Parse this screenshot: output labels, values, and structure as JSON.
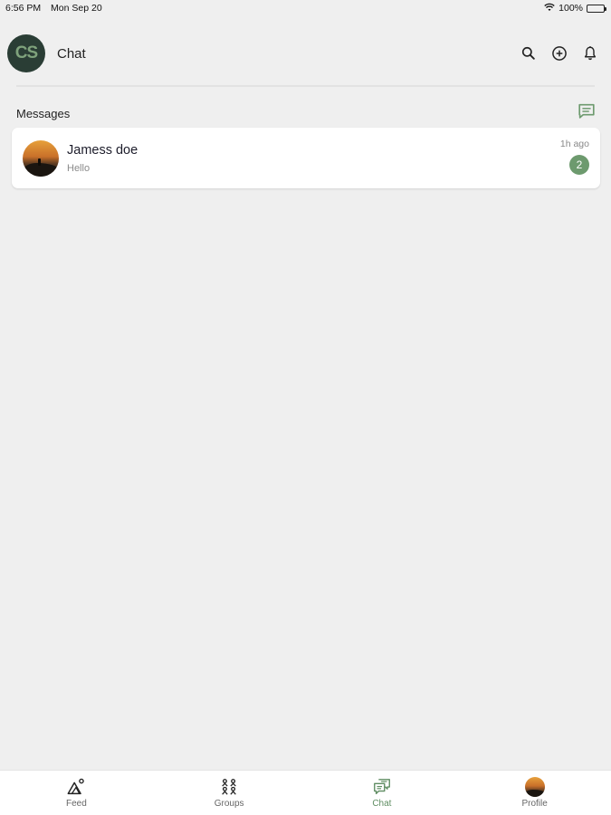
{
  "status_bar": {
    "time": "6:56 PM",
    "date": "Mon Sep 20",
    "battery": "100%",
    "battery_level": 1.0
  },
  "header": {
    "logo_text": "CS",
    "title": "Chat"
  },
  "messages": {
    "section_title": "Messages",
    "items": [
      {
        "name": "Jamess doe",
        "preview": "Hello",
        "time": "1h ago",
        "unread": "2"
      }
    ]
  },
  "bottom_nav": {
    "items": [
      {
        "label": "Feed",
        "icon": "mountain-icon"
      },
      {
        "label": "Groups",
        "icon": "groups-icon"
      },
      {
        "label": "Chat",
        "icon": "chat-icon",
        "active": true
      },
      {
        "label": "Profile",
        "icon": "profile-avatar"
      }
    ]
  },
  "colors": {
    "accent": "#6d9a6e",
    "logo_bg": "#2a3d35",
    "background": "#efefef"
  }
}
